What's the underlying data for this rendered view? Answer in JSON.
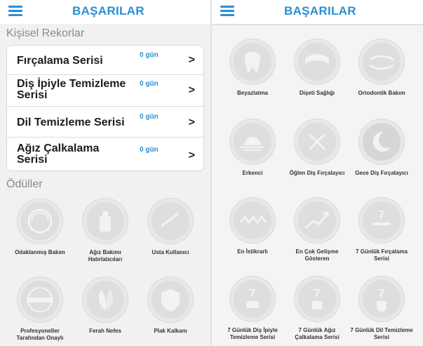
{
  "colors": {
    "accent": "#2a8fd0",
    "badge_gray": "#dedede"
  },
  "left": {
    "header": {
      "title": "BAŞARILAR",
      "menu_icon": "hamburger-menu-icon"
    },
    "records_title": "Kişisel Rekorlar",
    "records": [
      {
        "name": "Fırçalama Serisi",
        "days": "0 gün"
      },
      {
        "name": "Diş İpiyle Temizleme Serisi",
        "days": "0 gün"
      },
      {
        "name": "Dil Temizleme Serisi",
        "days": "0 gün"
      },
      {
        "name": "Ağız Çalkalama Serisi",
        "days": "0 gün"
      }
    ],
    "chevron": ">",
    "awards_title": "Ödüller",
    "awards": [
      {
        "label": "Odaklanmış Bakım",
        "icon": "focused-care-icon"
      },
      {
        "label": "Ağız Bakımı Hatırlatıcıları",
        "icon": "mouthwash-bottle-icon"
      },
      {
        "label": "Usta Kullanıcı",
        "icon": "check-mark-icon"
      },
      {
        "label": "Profesyoneller Tarafından Onaylı",
        "icon": "approved-stamp-icon"
      },
      {
        "label": "Ferah Nefes",
        "icon": "leaves-icon"
      },
      {
        "label": "Plak Kalkanı",
        "icon": "shield-icon"
      }
    ]
  },
  "right": {
    "header": {
      "title": "BAŞARILAR",
      "menu_icon": "hamburger-menu-icon"
    },
    "badges": [
      {
        "label": "Beyazlatma",
        "icon": "tooth-icon"
      },
      {
        "label": "Dişeti Sağlığı",
        "icon": "gums-icon"
      },
      {
        "label": "Ortodontik Bakım",
        "icon": "braces-icon"
      },
      {
        "label": "Erkenci",
        "icon": "sunrise-icon"
      },
      {
        "label": "Öğlen Diş Fırçalayıcı",
        "icon": "fork-knife-icon"
      },
      {
        "label": "Gece Diş Fırçalayıcı",
        "icon": "moon-icon"
      },
      {
        "label": "En İstikrarlı",
        "icon": "zigzag-icon"
      },
      {
        "label": "En Çok Gelişme Gösteren",
        "icon": "trend-up-icon"
      },
      {
        "label": "7 Günlük Fırçalama Serisi",
        "icon": "toothbrush-7-icon",
        "number": "7"
      },
      {
        "label": "7 Günlük Diş İpiyle Temizleme Serisi",
        "icon": "floss-7-icon",
        "number": "7"
      },
      {
        "label": "7 Günlük Ağız Çalkalama Serisi",
        "icon": "rinse-7-icon",
        "number": "7"
      },
      {
        "label": "7 Günlük Dil Temizleme Serisi",
        "icon": "tongue-7-icon",
        "number": "7"
      }
    ]
  }
}
